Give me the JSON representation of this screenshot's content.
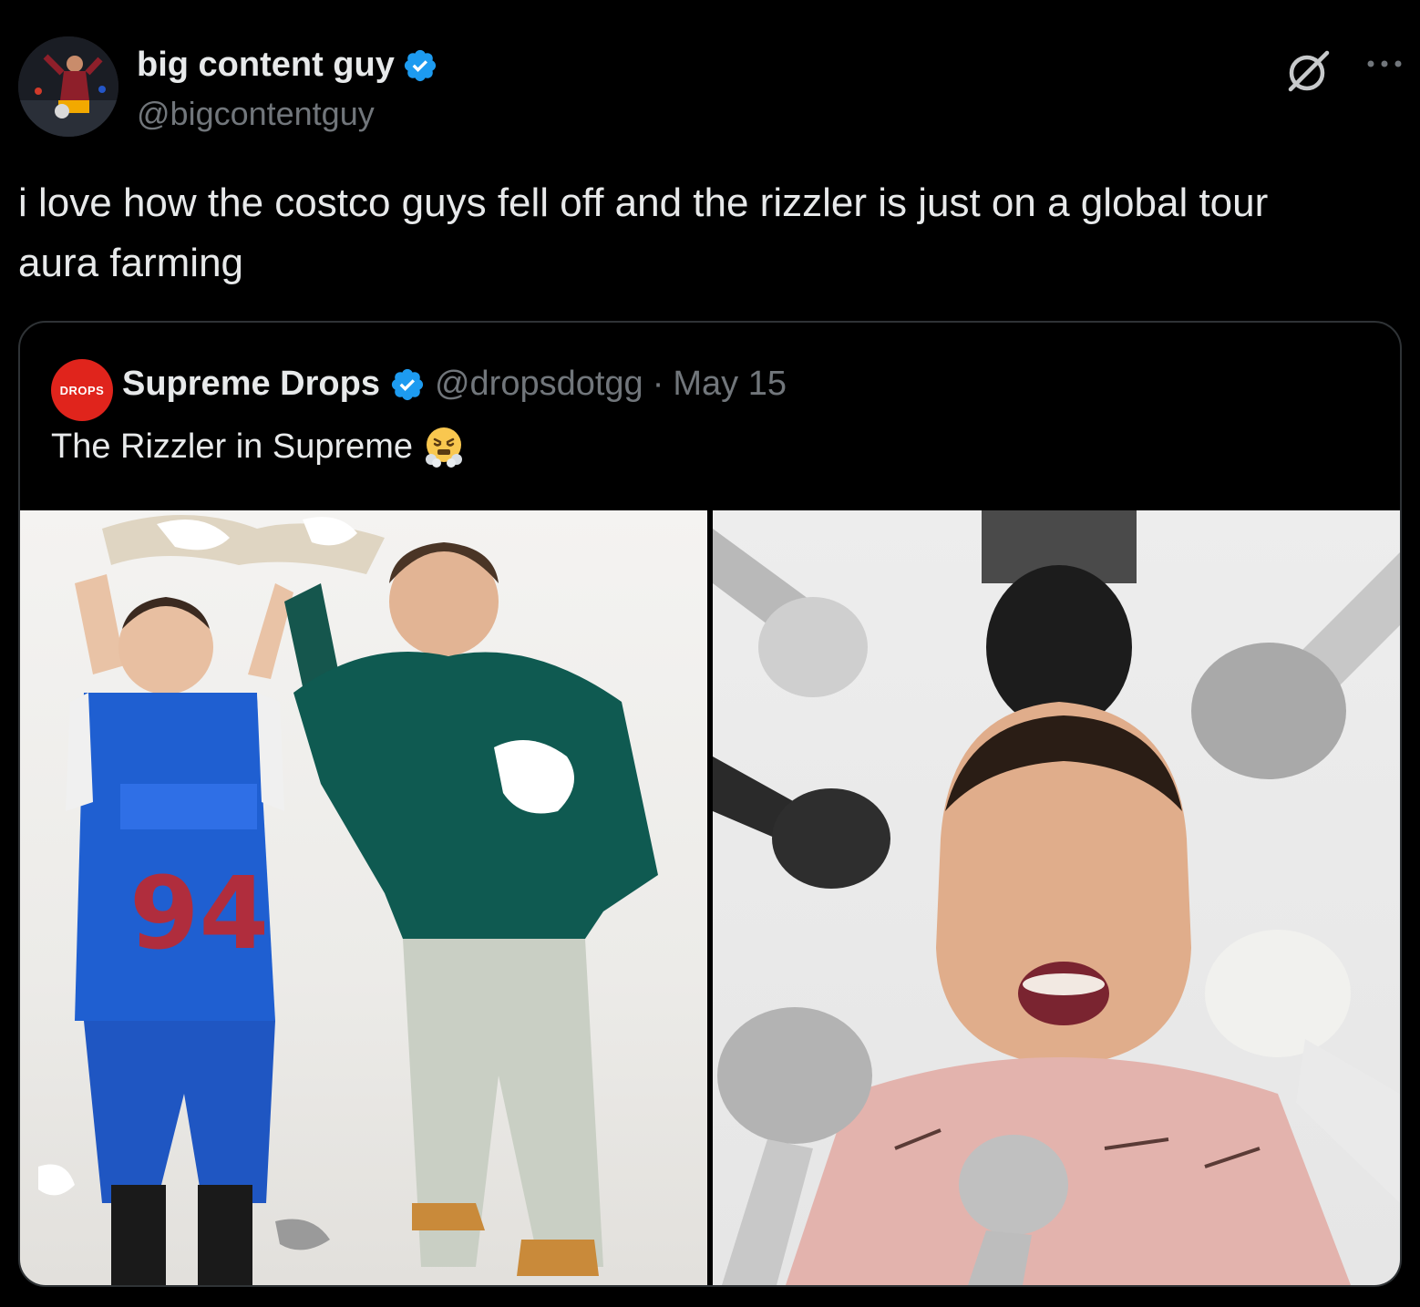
{
  "tweet": {
    "author": {
      "display_name": "big content guy",
      "handle": "@bigcontentguy",
      "verified": true,
      "avatar_icon": "avatar-photo"
    },
    "text": "i love how the costco guys fell off and the rizzler is just on a global tour\naura farming",
    "actions": {
      "grok_icon": "grok-icon",
      "more_icon": "more-icon"
    }
  },
  "quote": {
    "author": {
      "display_name": "Supreme Drops",
      "handle": "@dropsdotgg",
      "separator": "·",
      "date": "May 15",
      "verified": true,
      "avatar_text": "DROPS"
    },
    "text": "The Rizzler in Supreme",
    "emoji": "face-with-steam-emoji",
    "media": [
      {
        "icon": "photo-kid-and-man-throwing-paper"
      },
      {
        "icon": "photo-kid-surrounded-by-microphones"
      }
    ]
  },
  "colors": {
    "background": "#000000",
    "text_primary": "#e7e9ea",
    "text_secondary": "#71767b",
    "border": "#2f3336",
    "verified_blue": "#1d9bf0",
    "drops_red": "#e0241c"
  }
}
